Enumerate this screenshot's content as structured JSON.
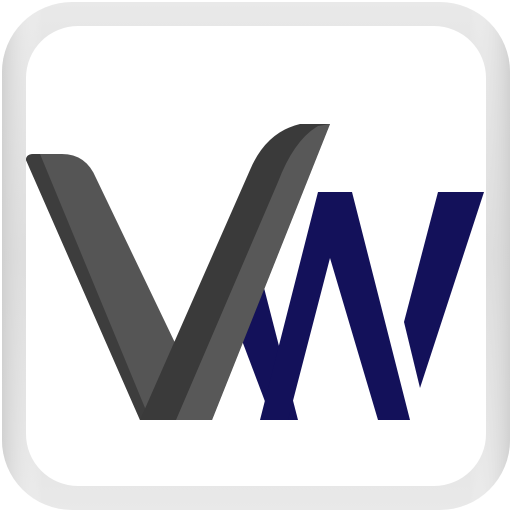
{
  "icon": {
    "semantic_name": "vw-logo-icon",
    "letters": "VW",
    "colors": {
      "background": "#ffffff",
      "frame_outer": "#cfcfcf",
      "frame_inner": "#f2f2f2",
      "v_light": "#585858",
      "v_dark": "#3a3a3a",
      "w_navy": "#13115a"
    }
  }
}
